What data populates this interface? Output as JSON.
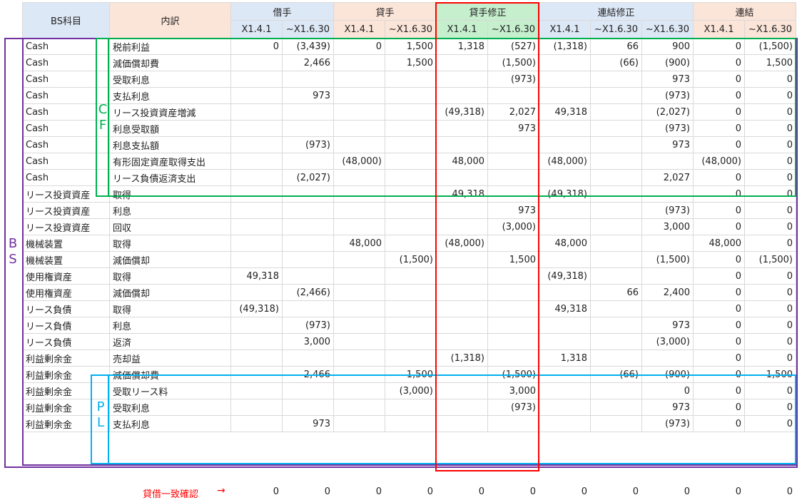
{
  "header": {
    "bs_item": "BS科目",
    "breakdown": "内訳",
    "groups": [
      "借手",
      "貸手",
      "貸手修正",
      "連結修正",
      "連結"
    ],
    "sub": [
      "X1.4.1",
      "~X1.6.30",
      "X1.4.1",
      "~X1.6.30",
      "X1.4.1",
      "~X1.6.30",
      "X1.4.1",
      "~X1.6.30",
      "~X1.6.30",
      "X1.4.1",
      "~X1.6.30"
    ]
  },
  "rows": [
    [
      "Cash",
      "税前利益",
      "0",
      "(3,439)",
      "0",
      "1,500",
      "1,318",
      "(527)",
      "(1,318)",
      "66",
      "900",
      "0",
      "(1,500)"
    ],
    [
      "Cash",
      "減価償却費",
      "",
      "2,466",
      "",
      "1,500",
      "",
      "(1,500)",
      "",
      "(66)",
      "(900)",
      "0",
      "1,500"
    ],
    [
      "Cash",
      "受取利息",
      "",
      "",
      "",
      "",
      "",
      "(973)",
      "",
      "",
      "973",
      "0",
      "0"
    ],
    [
      "Cash",
      "支払利息",
      "",
      "973",
      "",
      "",
      "",
      "",
      "",
      "",
      "(973)",
      "0",
      "0"
    ],
    [
      "Cash",
      "リース投資資産増減",
      "",
      "",
      "",
      "",
      "(49,318)",
      "2,027",
      "49,318",
      "",
      "(2,027)",
      "0",
      "0"
    ],
    [
      "Cash",
      "利息受取額",
      "",
      "",
      "",
      "",
      "",
      "973",
      "",
      "",
      "(973)",
      "0",
      "0"
    ],
    [
      "Cash",
      "利息支払額",
      "",
      "(973)",
      "",
      "",
      "",
      "",
      "",
      "",
      "973",
      "0",
      "0"
    ],
    [
      "Cash",
      "有形固定資産取得支出",
      "",
      "",
      "(48,000)",
      "",
      "48,000",
      "",
      "(48,000)",
      "",
      "",
      "(48,000)",
      "0"
    ],
    [
      "Cash",
      "リース負債返済支出",
      "",
      "(2,027)",
      "",
      "",
      "",
      "",
      "",
      "",
      "2,027",
      "0",
      "0"
    ],
    [
      "リース投資資産",
      "取得",
      "",
      "",
      "",
      "",
      "49,318",
      "",
      "(49,318)",
      "",
      "",
      "0",
      "0"
    ],
    [
      "リース投資資産",
      "利息",
      "",
      "",
      "",
      "",
      "",
      "973",
      "",
      "",
      "(973)",
      "0",
      "0"
    ],
    [
      "リース投資資産",
      "回収",
      "",
      "",
      "",
      "",
      "",
      "(3,000)",
      "",
      "",
      "3,000",
      "0",
      "0"
    ],
    [
      "機械装置",
      "取得",
      "",
      "",
      "48,000",
      "",
      "(48,000)",
      "",
      "48,000",
      "",
      "",
      "48,000",
      "0"
    ],
    [
      "機械装置",
      "減価償却",
      "",
      "",
      "",
      "(1,500)",
      "",
      "1,500",
      "",
      "",
      "(1,500)",
      "0",
      "(1,500)"
    ],
    [
      "使用権資産",
      "取得",
      "49,318",
      "",
      "",
      "",
      "",
      "",
      "(49,318)",
      "",
      "",
      "0",
      "0"
    ],
    [
      "使用権資産",
      "減価償却",
      "",
      "(2,466)",
      "",
      "",
      "",
      "",
      "",
      "66",
      "2,400",
      "0",
      "0"
    ],
    [
      "リース負債",
      "取得",
      "(49,318)",
      "",
      "",
      "",
      "",
      "",
      "49,318",
      "",
      "",
      "0",
      "0"
    ],
    [
      "リース負債",
      "利息",
      "",
      "(973)",
      "",
      "",
      "",
      "",
      "",
      "",
      "973",
      "0",
      "0"
    ],
    [
      "リース負債",
      "返済",
      "",
      "3,000",
      "",
      "",
      "",
      "",
      "",
      "",
      "(3,000)",
      "0",
      "0"
    ],
    [
      "利益剰余金",
      "売却益",
      "",
      "",
      "",
      "",
      "(1,318)",
      "",
      "1,318",
      "",
      "",
      "0",
      "0"
    ],
    [
      "利益剰余金",
      "減価償却費",
      "",
      "2,466",
      "",
      "1,500",
      "",
      "(1,500)",
      "",
      "(66)",
      "(900)",
      "0",
      "1,500"
    ],
    [
      "利益剰余金",
      "受取リース料",
      "",
      "",
      "",
      "(3,000)",
      "",
      "3,000",
      "",
      "",
      "0",
      "0",
      "0"
    ],
    [
      "利益剰余金",
      "受取利息",
      "",
      "",
      "",
      "",
      "",
      "(973)",
      "",
      "",
      "973",
      "0",
      "0"
    ],
    [
      "利益剰余金",
      "支払利息",
      "",
      "973",
      "",
      "",
      "",
      "",
      "",
      "",
      "(973)",
      "0",
      "0"
    ]
  ],
  "labels": {
    "bs": "B S",
    "cf": "C F",
    "pl": "P L"
  },
  "footer": {
    "label": "貸借一致確認",
    "arrow": "→",
    "values": [
      "0",
      "0",
      "0",
      "0",
      "0",
      "0",
      "0",
      "0",
      "0",
      "0",
      "0"
    ]
  },
  "colors": {
    "bs": "#7030a0",
    "cf": "#00b050",
    "pl": "#00b0f0",
    "check": "#ff0000"
  }
}
